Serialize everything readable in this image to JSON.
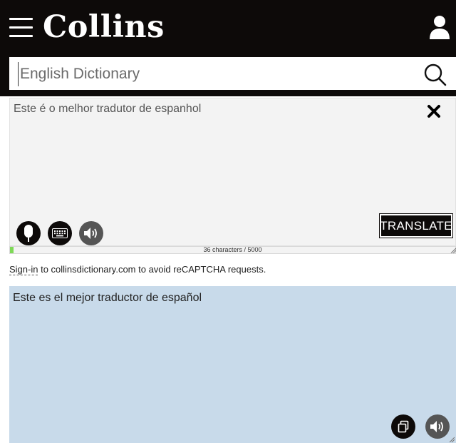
{
  "header": {
    "logo": "Collins",
    "menu_icon": "hamburger-menu-icon",
    "user_icon": "user-icon"
  },
  "search": {
    "placeholder": "English Dictionary",
    "value": "",
    "icon": "search-icon"
  },
  "source": {
    "text": "Este é o melhor tradutor de espanhol",
    "clear_icon": "close-icon",
    "translate_label": "TRANSLATE",
    "counter_text": "36 characters / 5000",
    "char_count": 36,
    "char_limit": 5000
  },
  "signin": {
    "link": "Sign-in",
    "rest": " to collinsdictionary.com to avoid reCAPTCHA requests."
  },
  "result": {
    "text": "Este es el mejor traductor de español"
  },
  "colors": {
    "header_bg": "#0d0a09",
    "source_bg": "#f3f3f3",
    "result_bg": "#c8daea",
    "counter_fill": "#7ed957"
  }
}
